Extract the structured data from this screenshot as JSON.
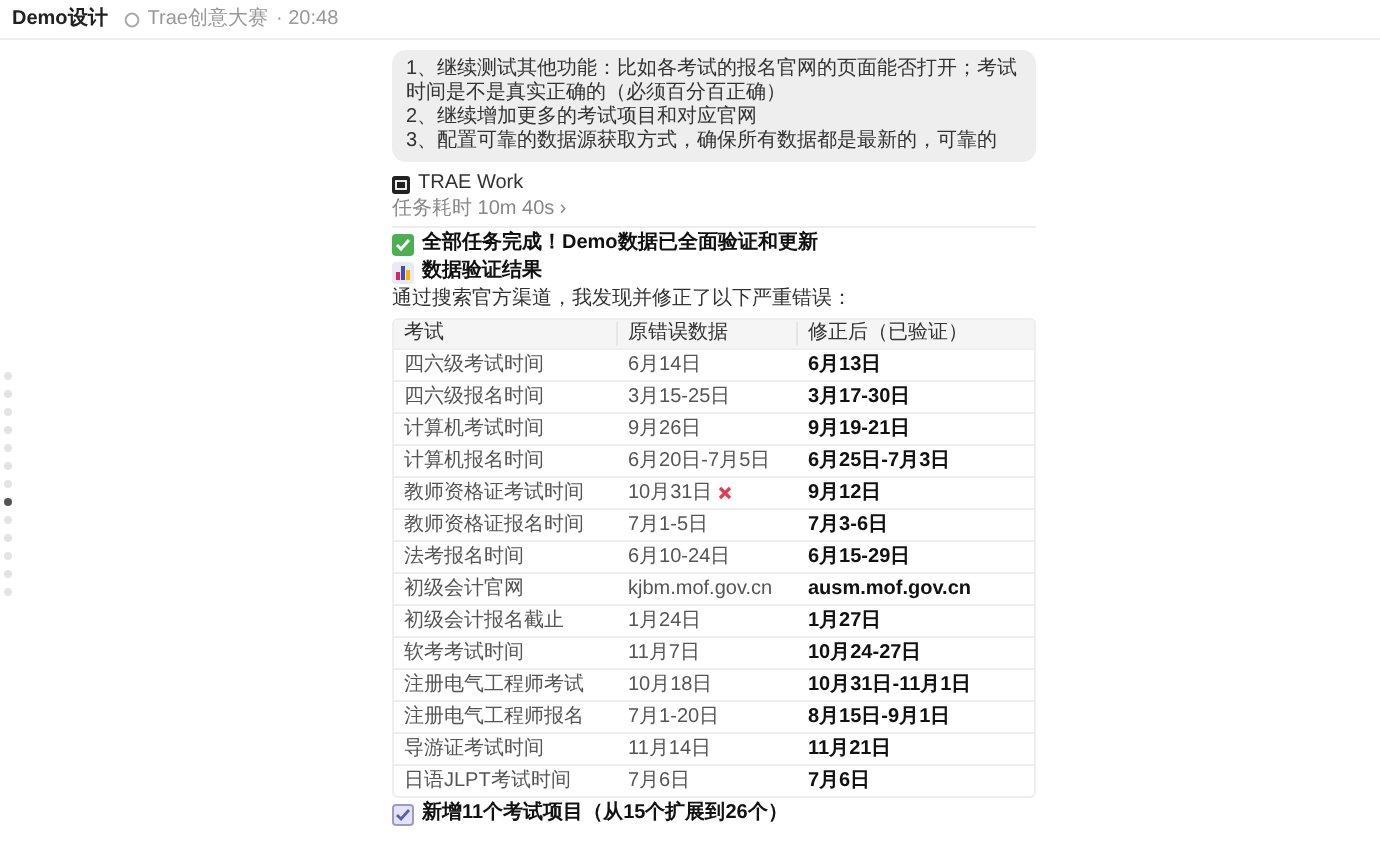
{
  "header": {
    "title": "Demo设计",
    "project": "Trae创意大赛",
    "time": "· 20:48"
  },
  "nav_dots": [
    {
      "selected": false
    },
    {
      "selected": false
    },
    {
      "selected": false
    },
    {
      "selected": false
    },
    {
      "selected": false
    },
    {
      "selected": false
    },
    {
      "selected": false
    },
    {
      "selected": true
    },
    {
      "selected": false
    },
    {
      "selected": false
    },
    {
      "selected": false
    },
    {
      "selected": false
    },
    {
      "selected": false
    }
  ],
  "user_message": [
    "1、继续测试其他功能：比如各考试的报名官网的页面能否打开；考试时间是不是真实正确的（必须百分百正确）",
    "2、继续增加更多的考试项目和对应官网",
    "3、配置可靠的数据源获取方式，确保所有数据都是最新的，可靠的"
  ],
  "agent": {
    "name": "TRAE Work",
    "duration": "任务耗时 10m 40s ›"
  },
  "headings": [
    {
      "kind": "done",
      "text": "全部任务完成！Demo数据已全面验证和更新"
    },
    {
      "kind": "chart",
      "text": "数据验证结果"
    }
  ],
  "intro": "通过搜索官方渠道，我发现并修正了以下严重错误：",
  "table": {
    "columns": [
      "考试",
      "原错误数据",
      "修正后（已验证）"
    ],
    "rows": [
      {
        "exam": "四六级考试时间",
        "wrong": "6月14日",
        "flagged": false,
        "fixed": "6月13日"
      },
      {
        "exam": "四六级报名时间",
        "wrong": "3月15-25日",
        "flagged": false,
        "fixed": "3月17-30日"
      },
      {
        "exam": "计算机考试时间",
        "wrong": "9月26日",
        "flagged": false,
        "fixed": "9月19-21日"
      },
      {
        "exam": "计算机报名时间",
        "wrong": "6月20日-7月5日",
        "flagged": false,
        "fixed": "6月25日-7月3日"
      },
      {
        "exam": "教师资格证考试时间",
        "wrong": "10月31日",
        "flagged": true,
        "fixed": "9月12日"
      },
      {
        "exam": "教师资格证报名时间",
        "wrong": "7月1-5日",
        "flagged": false,
        "fixed": "7月3-6日"
      },
      {
        "exam": "法考报名时间",
        "wrong": "6月10-24日",
        "flagged": false,
        "fixed": "6月15-29日"
      },
      {
        "exam": "初级会计官网",
        "wrong": "kjbm.mof.gov.cn",
        "flagged": false,
        "fixed": "ausm.mof.gov.cn"
      },
      {
        "exam": "初级会计报名截止",
        "wrong": "1月24日",
        "flagged": false,
        "fixed": "1月27日"
      },
      {
        "exam": "软考考试时间",
        "wrong": "11月7日",
        "flagged": false,
        "fixed": "10月24-27日"
      },
      {
        "exam": "注册电气工程师考试",
        "wrong": "10月18日",
        "flagged": false,
        "fixed": "10月31日-11月1日"
      },
      {
        "exam": "注册电气工程师报名",
        "wrong": "7月1-20日",
        "flagged": false,
        "fixed": "8月15日-9月1日"
      },
      {
        "exam": "导游证考试时间",
        "wrong": "11月14日",
        "flagged": false,
        "fixed": "11月21日"
      },
      {
        "exam": "日语JLPT考试时间",
        "wrong": "7月6日",
        "flagged": false,
        "fixed": "7月6日"
      }
    ]
  },
  "footer_heading": {
    "kind": "check",
    "text": "新增11个考试项目（从15个扩展到26个）"
  }
}
